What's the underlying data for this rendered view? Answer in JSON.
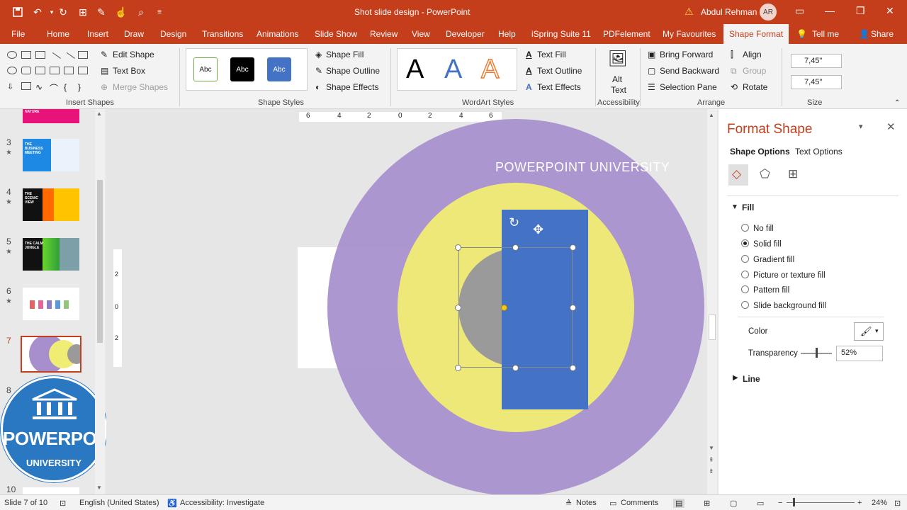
{
  "titlebar": {
    "doc_title": "Shot slide design  -  PowerPoint",
    "user_name": "Abdul Rehman",
    "user_initials": "AR"
  },
  "menu": {
    "tabs": [
      "File",
      "Home",
      "Insert",
      "Draw",
      "Design",
      "Transitions",
      "Animations",
      "Slide Show",
      "Review",
      "View",
      "Developer",
      "Help",
      "iSpring Suite 11",
      "PDFelement",
      "My Favourites",
      "Shape Format"
    ],
    "active_tab": "Shape Format",
    "tell_me": "Tell me",
    "share": "Share"
  },
  "ribbon": {
    "insert_shapes": {
      "label": "Insert Shapes",
      "edit_shape": "Edit Shape",
      "text_box": "Text Box",
      "merge_shapes": "Merge Shapes"
    },
    "shape_styles": {
      "label": "Shape Styles",
      "swatch_text": "Abc",
      "shape_fill": "Shape Fill",
      "shape_outline": "Shape Outline",
      "shape_effects": "Shape Effects"
    },
    "wordart": {
      "label": "WordArt Styles",
      "sample": "A",
      "text_fill": "Text Fill",
      "text_outline": "Text Outline",
      "text_effects": "Text Effects"
    },
    "accessibility": {
      "label": "Accessibility",
      "alt_text_line1": "Alt",
      "alt_text_line2": "Text"
    },
    "arrange": {
      "label": "Arrange",
      "bring_forward": "Bring Forward",
      "send_backward": "Send Backward",
      "selection_pane": "Selection Pane",
      "align": "Align",
      "group": "Group",
      "rotate": "Rotate"
    },
    "size": {
      "label": "Size",
      "height": "7,45\"",
      "width": "7,45\""
    }
  },
  "slides": [
    {
      "num": "3",
      "star": "★",
      "text": "THE BUSINESS MEETING"
    },
    {
      "num": "4",
      "star": "★",
      "text": "THE SCENIC VIEW"
    },
    {
      "num": "5",
      "star": "★",
      "text": "THE CALM JUNGLE"
    },
    {
      "num": "6",
      "star": "★",
      "text": ""
    },
    {
      "num": "7",
      "star": "",
      "text": ""
    },
    {
      "num": "8",
      "star": "",
      "text": ""
    },
    {
      "num": "10",
      "star": "",
      "text": ""
    }
  ],
  "top_thumb_text": "NATURE",
  "watermark": {
    "line1": "POWERPOINT",
    "line2": "UNIVERSITY"
  },
  "canvas": {
    "slide_watermark": "POWERPOINT UNIVERSITY",
    "ruler_ticks": [
      "6",
      "4",
      "2",
      "0",
      "2",
      "4",
      "6"
    ],
    "vruler_ticks": [
      "2",
      "0",
      "2"
    ]
  },
  "format_pane": {
    "title": "Format Shape",
    "tab_shape": "Shape Options",
    "tab_text": "Text Options",
    "fill_section": "Fill",
    "fill_options": [
      "No fill",
      "Solid fill",
      "Gradient fill",
      "Picture or texture fill",
      "Pattern fill",
      "Slide background fill"
    ],
    "selected_fill": "Solid fill",
    "color_label": "Color",
    "transparency_label": "Transparency",
    "transparency_value": "52%",
    "transparency_fraction": 0.52,
    "line_section": "Line"
  },
  "statusbar": {
    "slide_info": "Slide 7 of 10",
    "language": "English (United States)",
    "accessibility": "Accessibility: Investigate",
    "notes": "Notes",
    "comments": "Comments",
    "zoom": "24%"
  },
  "colors": {
    "accent": "#c43e1c",
    "purple": "#a68fcc",
    "yellow": "#f1ec74",
    "blue": "#4472c4",
    "gray": "#9a9a9a"
  }
}
